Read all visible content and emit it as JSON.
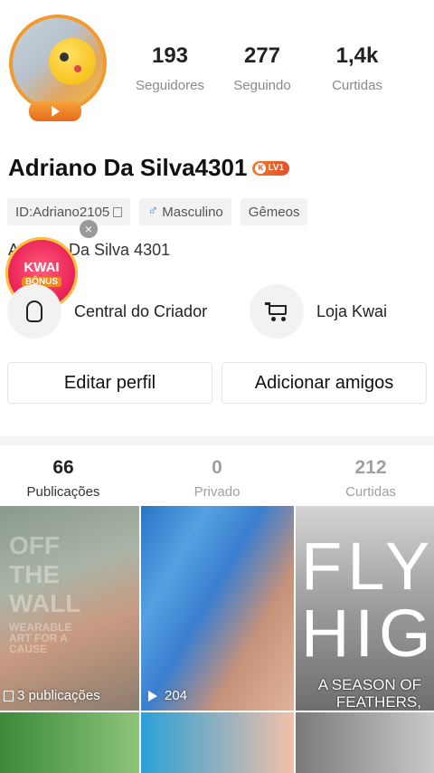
{
  "profile": {
    "stats": [
      {
        "value": "193",
        "label": "Seguidores"
      },
      {
        "value": "277",
        "label": "Seguindo"
      },
      {
        "value": "1,4k",
        "label": "Curtidas"
      }
    ],
    "name": "Adriano Da Silva4301",
    "level_badge": "LV1",
    "chips": {
      "id": "ID:Adriano2105",
      "gender": "Masculino",
      "sign": "Gêmeos"
    },
    "bio": "Adriano Da Silva 4301"
  },
  "bonus": {
    "line1": "KWAI",
    "line2": "BÔNUS",
    "close": "×"
  },
  "actions": {
    "creator_center": "Central do Criador",
    "shop": "Loja Kwai"
  },
  "buttons": {
    "edit_profile": "Editar perfil",
    "add_friends": "Adicionar amigos"
  },
  "tabs": [
    {
      "count": "66",
      "label": "Publicações"
    },
    {
      "count": "0",
      "label": "Privado"
    },
    {
      "count": "212",
      "label": "Curtidas"
    }
  ],
  "grid": {
    "item1": {
      "overlay": "3 publicações",
      "watermark1": "OFF",
      "watermark2": "THE",
      "watermark3": "WALL",
      "watermark4": "WEARABLE ART FOR A CAUSE"
    },
    "item2": {
      "views": "204"
    },
    "item3": {
      "headline": "FLY HIGH",
      "tagline": "A SEASON OF FEATHERS, FLORALS, FAUX FUR AND FUN!"
    }
  },
  "colors": {
    "accent": "#f29a2e",
    "bonus": "#e81a55",
    "male": "#2c8ae0"
  }
}
